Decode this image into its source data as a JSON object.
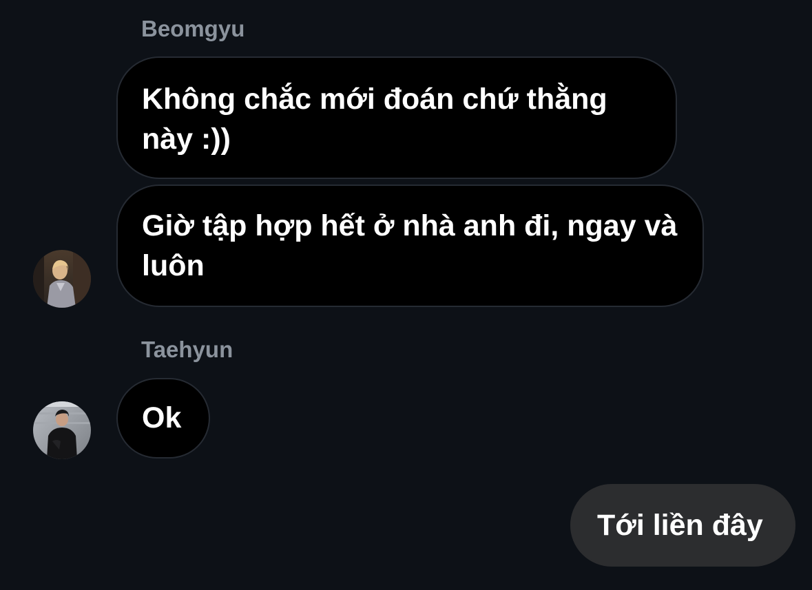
{
  "conversation": {
    "groups": [
      {
        "sender": "Beomgyu",
        "avatar_icon": "user-avatar-photo-icon",
        "messages": [
          "Không chắc mới đoán chứ thằng này :))",
          "Giờ tập hợp hết ở nhà anh đi, ngay và luôn"
        ]
      },
      {
        "sender": "Taehyun",
        "avatar_icon": "user-avatar-photo-icon",
        "messages": [
          "Ok"
        ]
      }
    ],
    "outgoing": [
      "Tới liền đây"
    ]
  },
  "colors": {
    "background": "#0d1117",
    "incoming_bubble": "#000000",
    "incoming_border": "#262b33",
    "outgoing_bubble": "#2c2d2f",
    "sender_name": "#8b939d",
    "text": "#ffffff"
  }
}
